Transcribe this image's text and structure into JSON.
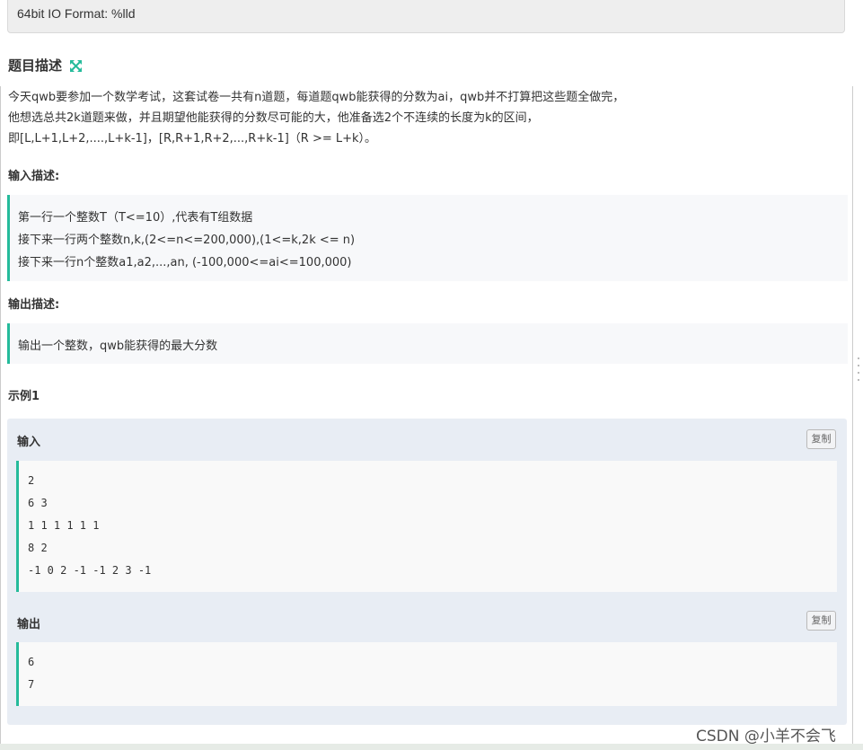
{
  "io_format": "64bit IO Format: %lld",
  "description": {
    "title": "题目描述",
    "expand_icon": "expand-arrows-icon",
    "lines": [
      "今天qwb要参加一个数学考试，这套试卷一共有n道题，每道题qwb能获得的分数为ai，qwb并不打算把这些题全做完，",
      "他想选总共2k道题来做，并且期望他能获得的分数尽可能的大，他准备选2个不连续的长度为k的区间，",
      "即[L,L+1,L+2,....,L+k-1]，[R,R+1,R+2,...,R+k-1]（R >= L+k）。"
    ]
  },
  "input_desc": {
    "title": "输入描述:",
    "lines": [
      "第一行一个整数T（T<=10）,代表有T组数据",
      "接下来一行两个整数n,k,(2<=n<=200,000),(1<=k,2k <= n)",
      "接下来一行n个整数a1,a2,...,an, (-100,000<=ai<=100,000)"
    ]
  },
  "output_desc": {
    "title": "输出描述:",
    "lines": [
      "输出一个整数，qwb能获得的最大分数"
    ]
  },
  "example": {
    "title": "示例1",
    "input_label": "输入",
    "output_label": "输出",
    "copy_label": "复制",
    "input_lines": [
      "2",
      "6 3",
      "1 1 1 1 1 1",
      "8 2",
      "-1 0 2 -1 -1 2 3 -1"
    ],
    "output_lines": [
      "6",
      "7"
    ]
  },
  "watermark": "CSDN @小羊不会飞",
  "colors": {
    "accent": "#25bb9b",
    "panel": "#e8edf4",
    "format_bg": "#eeeeee"
  }
}
